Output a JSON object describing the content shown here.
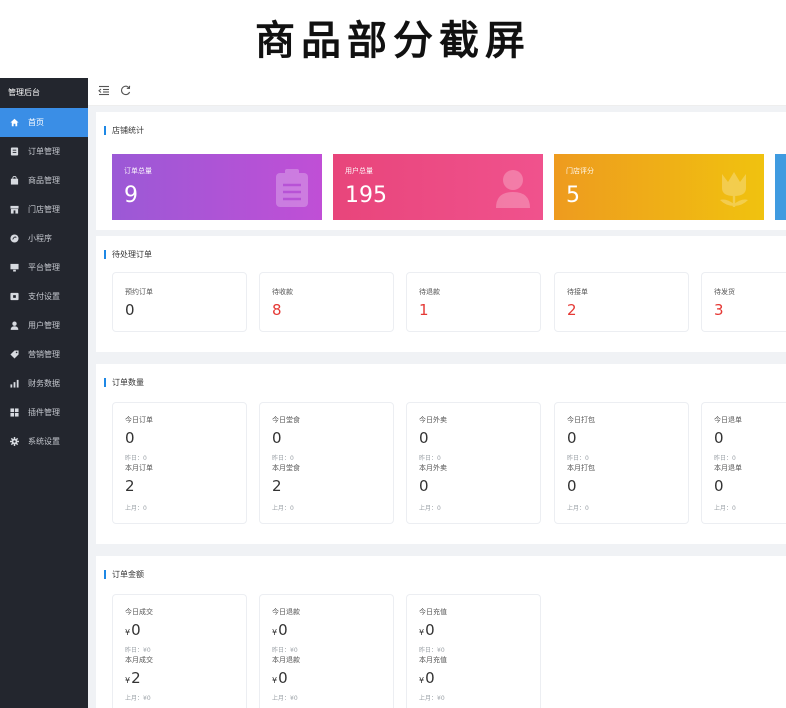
{
  "banner": {
    "title": "商品部分截屏"
  },
  "sidebar": {
    "brand": "管理后台",
    "items": [
      {
        "label": "首页",
        "icon": "home-icon",
        "active": true
      },
      {
        "label": "订单管理",
        "icon": "order-icon"
      },
      {
        "label": "商品管理",
        "icon": "goods-icon"
      },
      {
        "label": "门店管理",
        "icon": "store-icon"
      },
      {
        "label": "小程序",
        "icon": "miniapp-icon"
      },
      {
        "label": "平台管理",
        "icon": "platform-icon"
      },
      {
        "label": "支付设置",
        "icon": "payment-icon"
      },
      {
        "label": "用户管理",
        "icon": "user-icon"
      },
      {
        "label": "营销管理",
        "icon": "tag-icon"
      },
      {
        "label": "财务数据",
        "icon": "finance-icon"
      },
      {
        "label": "插件管理",
        "icon": "plugin-icon"
      },
      {
        "label": "系统设置",
        "icon": "settings-icon"
      }
    ]
  },
  "topbar": {
    "fold_icon": "menu-fold-icon",
    "refresh_icon": "refresh-icon"
  },
  "store_stats": {
    "title": "店铺统计",
    "cards": [
      {
        "label": "订单总量",
        "value": "9",
        "icon": "clipboard-icon",
        "color_from": "#9b59d6",
        "color_to": "#c04fd6"
      },
      {
        "label": "用户总量",
        "value": "195",
        "icon": "user-silhouette-icon",
        "color_from": "#e8457b",
        "color_to": "#f0528d"
      },
      {
        "label": "门店评分",
        "value": "5",
        "icon": "flower-icon",
        "color_from": "#ee9b1f",
        "color_to": "#f0c20f"
      }
    ],
    "extra_color": "#3f9be0"
  },
  "pending_orders": {
    "title": "待处理订单",
    "items": [
      {
        "label": "预约订单",
        "value": "0",
        "alert": false
      },
      {
        "label": "待收款",
        "value": "8",
        "alert": true
      },
      {
        "label": "待退款",
        "value": "1",
        "alert": true
      },
      {
        "label": "待接单",
        "value": "2",
        "alert": true
      },
      {
        "label": "待发货",
        "value": "3",
        "alert": true
      }
    ]
  },
  "order_count": {
    "title": "订单数量",
    "items": [
      {
        "today_label": "今日订单",
        "today_value": "0",
        "yesterday": "昨日：0",
        "month_label": "本月订单",
        "month_value": "2",
        "last_month": "上月：0"
      },
      {
        "today_label": "今日堂食",
        "today_value": "0",
        "yesterday": "昨日：0",
        "month_label": "本月堂食",
        "month_value": "2",
        "last_month": "上月：0"
      },
      {
        "today_label": "今日外卖",
        "today_value": "0",
        "yesterday": "昨日：0",
        "month_label": "本月外卖",
        "month_value": "0",
        "last_month": "上月：0"
      },
      {
        "today_label": "今日打包",
        "today_value": "0",
        "yesterday": "昨日：0",
        "month_label": "本月打包",
        "month_value": "0",
        "last_month": "上月：0"
      },
      {
        "today_label": "今日退单",
        "today_value": "0",
        "yesterday": "昨日：0",
        "month_label": "本月退单",
        "month_value": "0",
        "last_month": "上月：0"
      }
    ]
  },
  "order_amount": {
    "title": "订单金额",
    "currency": "¥",
    "items": [
      {
        "today_label": "今日成交",
        "today_value": "0",
        "yesterday": "昨日：¥0",
        "month_label": "本月成交",
        "month_value": "2",
        "last_month": "上月：¥0"
      },
      {
        "today_label": "今日退款",
        "today_value": "0",
        "yesterday": "昨日：¥0",
        "month_label": "本月退款",
        "month_value": "0",
        "last_month": "上月：¥0"
      },
      {
        "today_label": "今日充值",
        "today_value": "0",
        "yesterday": "昨日：¥0",
        "month_label": "本月充值",
        "month_value": "0",
        "last_month": "上月：¥0"
      }
    ]
  }
}
